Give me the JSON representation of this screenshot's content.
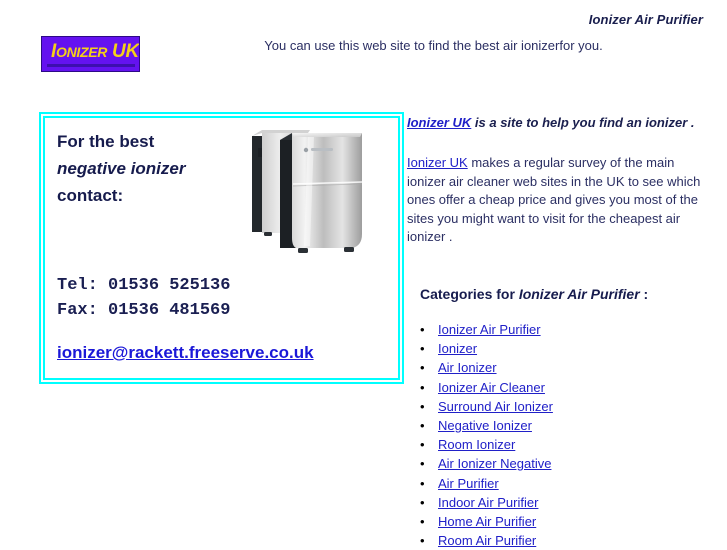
{
  "header": {
    "title": "Ionizer Air Purifier",
    "tagline": "You can use this web site to find the best air ionizerfor you."
  },
  "logo": {
    "lead": "I",
    "rest": "ONIZER",
    "suffix": " UK",
    "background_color": "#6412f0",
    "text_color": "#f5d118"
  },
  "contact": {
    "line1": "For the best",
    "line2": "negative ionizer",
    "line3": "contact:",
    "tel": "Tel: 01536 525136",
    "fax": "Fax: 01536 481569",
    "email": "ionizer@rackett.freeserve.co.uk",
    "border_color": "#00ffff",
    "image_alt": "air-purifier-product-photo"
  },
  "intro": {
    "lead_link": "Ionizer UK",
    "lead_rest": " is a site to help you find an ionizer .",
    "body_link": "Ionizer UK",
    "body_rest": " makes a regular survey of the main ionizer air cleaner web sites in the UK to see which ones offer a cheap price and gives you most of the sites you might want to visit for the cheapest air ionizer ."
  },
  "categories": {
    "heading_prefix": "Categories for ",
    "heading_term": "Ionizer Air Purifier",
    "heading_suffix": " :",
    "items": [
      " Ionizer Air Purifier",
      " Ionizer",
      " Air Ionizer",
      " Ionizer Air Cleaner",
      " Surround Air Ionizer",
      " Negative Ionizer",
      " Room Ionizer",
      " Air Ionizer Negative",
      " Air Purifier",
      " Indoor Air Purifier",
      " Home Air Purifier",
      " Room Air Purifier"
    ],
    "link_color": "#2020c8"
  }
}
